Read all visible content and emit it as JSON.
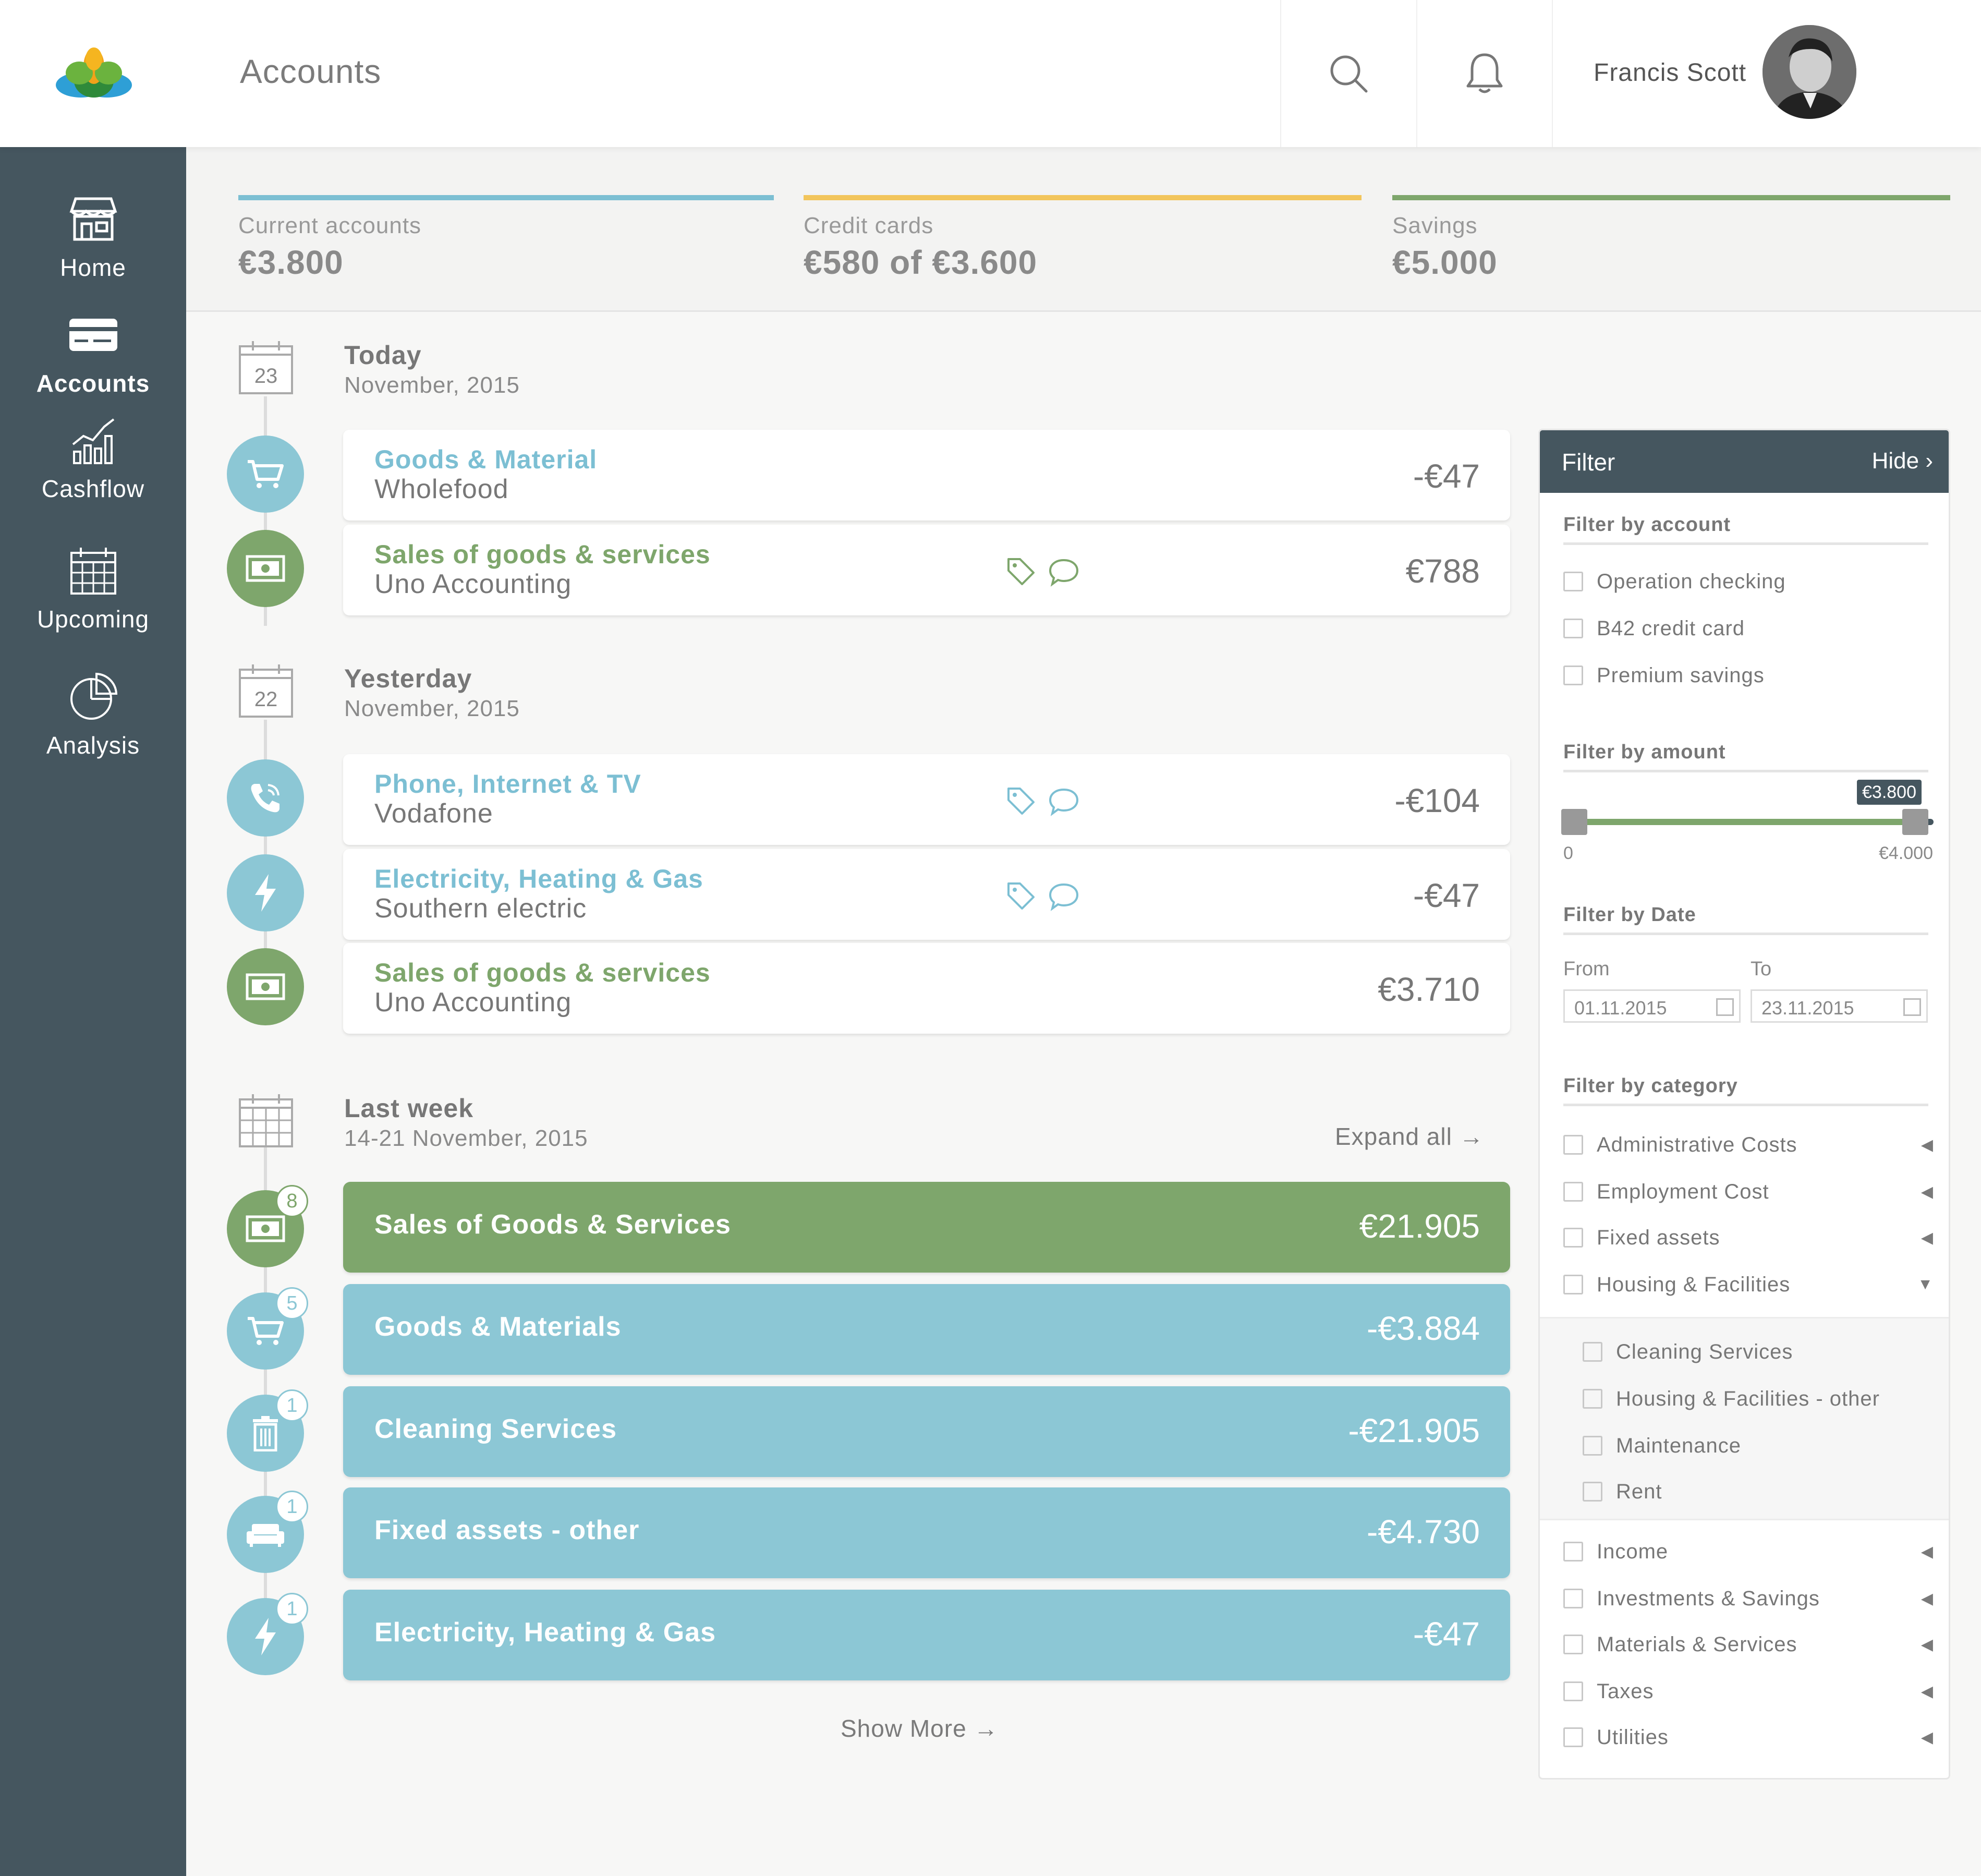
{
  "header": {
    "title": "Accounts",
    "user_name": "Francis Scott"
  },
  "sidebar": {
    "items": [
      {
        "label": "Home",
        "icon": "store-icon"
      },
      {
        "label": "Accounts",
        "icon": "card-icon",
        "active": true
      },
      {
        "label": "Cashflow",
        "icon": "bar-chart-icon"
      },
      {
        "label": "Upcoming",
        "icon": "calendar-icon"
      },
      {
        "label": "Analysis",
        "icon": "pie-chart-icon"
      }
    ]
  },
  "summary": [
    {
      "label": "Current accounts",
      "value": "€3.800",
      "color": "#7cbfd3"
    },
    {
      "label": "Credit cards",
      "value": "€580 of €3.600",
      "color": "#f2c55c"
    },
    {
      "label": "Savings",
      "value": "€5.000",
      "color": "#7ea66c"
    }
  ],
  "groups": {
    "today": {
      "day": "23",
      "title": "Today",
      "sub": "November, 2015"
    },
    "yesterday": {
      "day": "22",
      "title": "Yesterday",
      "sub": "November, 2015"
    },
    "lastweek": {
      "title": "Last week",
      "sub": "14-21 November, 2015",
      "expand": "Expand all"
    }
  },
  "transactions": [
    {
      "category": "Goods & Material",
      "merchant": "Wholefood",
      "amount": "-€47"
    },
    {
      "category": "Sales of goods & services",
      "merchant": "Uno Accounting",
      "amount": "€788"
    },
    {
      "category": "Phone, Internet & TV",
      "merchant": "Vodafone",
      "amount": "-€104"
    },
    {
      "category": "Electricity, Heating & Gas",
      "merchant": "Southern electric",
      "amount": "-€47"
    },
    {
      "category": "Sales of goods & services",
      "merchant": "Uno Accounting",
      "amount": "€3.710"
    }
  ],
  "weekly": [
    {
      "label": "Sales of Goods & Services",
      "amount": "€21.905",
      "count": "8"
    },
    {
      "label": "Goods & Materials",
      "amount": "-€3.884",
      "count": "5"
    },
    {
      "label": "Cleaning Services",
      "amount": "-€21.905",
      "count": "1"
    },
    {
      "label": "Fixed assets - other",
      "amount": "-€4.730",
      "count": "1"
    },
    {
      "label": "Electricity, Heating & Gas",
      "amount": "-€47",
      "count": "1"
    }
  ],
  "show_more": "Show More",
  "filter": {
    "title": "Filter",
    "hide": "Hide",
    "by_account": "Filter by account",
    "accounts": [
      "Operation checking",
      "B42 credit card",
      "Premium savings"
    ],
    "by_amount": "Filter by amount",
    "amount_min": "0",
    "amount_max": "€4.000",
    "amount_selected": "€3.800",
    "amount_fraction": 0.95,
    "by_date": "Filter by Date",
    "from_label": "From",
    "to_label": "To",
    "from_value": "01.11.2015",
    "to_value": "23.11.2015",
    "by_category": "Filter by category",
    "categories_top": [
      "Administrative Costs",
      "Employment Cost",
      "Fixed assets",
      "Housing & Facilities"
    ],
    "subcategories": [
      "Cleaning Services",
      "Housing & Facilities - other",
      "Maintenance",
      "Rent"
    ],
    "categories_bottom": [
      "Income",
      "Investments & Savings",
      "Materials & Services",
      "Taxes",
      "Utilities"
    ]
  },
  "colors": {
    "green": "#7ea66c",
    "blue": "#8cc7d5",
    "dark": "#45565f",
    "yellow": "#f2c55c"
  }
}
